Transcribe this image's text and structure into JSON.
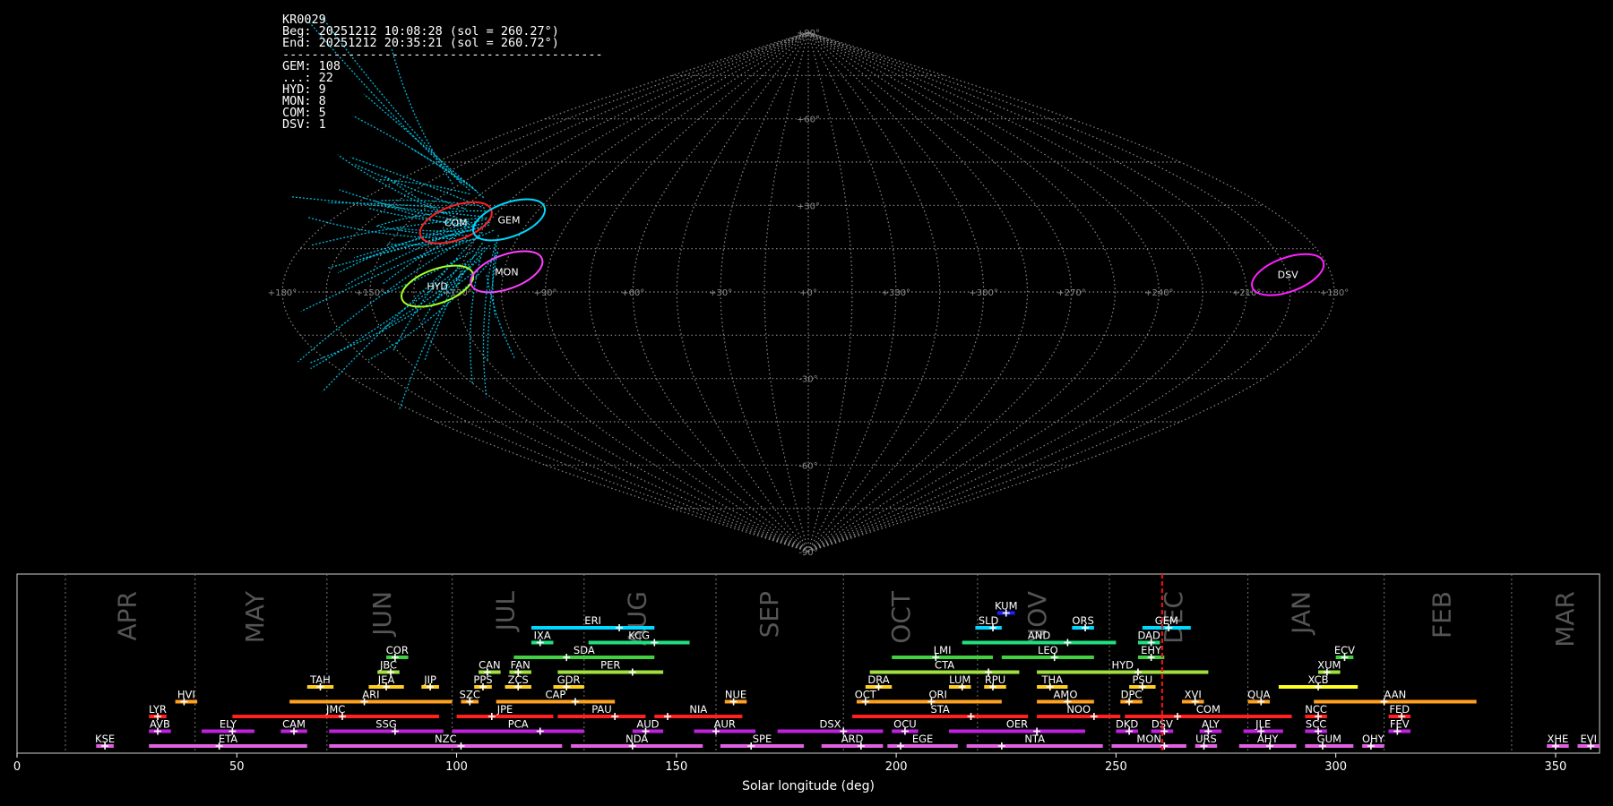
{
  "header": {
    "station": "KR0029",
    "beg": "Beg: 20251212 10:08:28 (sol = 260.27°)",
    "end": "End: 20251212 20:35:21 (sol = 260.72°)",
    "separator": "--------------------------------------------",
    "counts": [
      "GEM: 108",
      "...: 22",
      "HYD: 9",
      "MON: 8",
      "COM: 5",
      "DSV: 1"
    ]
  },
  "chart_data": [
    {
      "type": "scatter",
      "projection": "sinusoidal",
      "lon_labels": [
        {
          "lon": 180,
          "text": "+180°"
        },
        {
          "lon": 150,
          "text": "+150°"
        },
        {
          "lon": 120,
          "text": "+120°"
        },
        {
          "lon": 90,
          "text": "+90°"
        },
        {
          "lon": 60,
          "text": "+60°"
        },
        {
          "lon": 30,
          "text": "+30°"
        },
        {
          "lon": 0,
          "text": "+0°"
        },
        {
          "lon": -30,
          "text": "+330°"
        },
        {
          "lon": -60,
          "text": "+300°"
        },
        {
          "lon": -90,
          "text": "+270°"
        },
        {
          "lon": -120,
          "text": "+240°"
        },
        {
          "lon": -150,
          "text": "+210°"
        },
        {
          "lon": -180,
          "text": "+180°"
        }
      ],
      "lat_labels": [
        {
          "lat": 90,
          "text": "+90°"
        },
        {
          "lat": 60,
          "text": "+60°"
        },
        {
          "lat": 30,
          "text": "+30°"
        },
        {
          "lat": -30,
          "text": "-30°"
        },
        {
          "lat": -60,
          "text": "-60°"
        },
        {
          "lat": -90,
          "text": "-90°"
        }
      ],
      "radiants": [
        {
          "code": "COM",
          "lon": 132,
          "lat": 24,
          "color": "#ff2020"
        },
        {
          "code": "GEM",
          "lon": 113,
          "lat": 25,
          "color": "#00d8ff"
        },
        {
          "code": "HYD",
          "lon": 127,
          "lat": 2,
          "color": "#a8ff20"
        },
        {
          "code": "MON",
          "lon": 104,
          "lat": 7,
          "color": "#ff40ff"
        },
        {
          "code": "DSV",
          "lon": -165,
          "lat": 6,
          "color": "#ff20ff"
        }
      ],
      "trails_color": "#00d8ff"
    },
    {
      "type": "timeline",
      "xlabel": "Solar longitude (deg)",
      "xlim": [
        0,
        360
      ],
      "xticks": [
        0,
        50,
        100,
        150,
        200,
        250,
        300,
        350
      ],
      "current_sol": 260.5,
      "month_lines": [
        11,
        40.5,
        70.5,
        99,
        129,
        159,
        188,
        218.5,
        248.5,
        280,
        311,
        340
      ],
      "months": [
        {
          "text": "APR",
          "sol": 25
        },
        {
          "text": "MAY",
          "sol": 54
        },
        {
          "text": "JUN",
          "sol": 83
        },
        {
          "text": "JUL",
          "sol": 111
        },
        {
          "text": "AUG",
          "sol": 141
        },
        {
          "text": "SEP",
          "sol": 171
        },
        {
          "text": "OCT",
          "sol": 201
        },
        {
          "text": "NOV",
          "sol": 232
        },
        {
          "text": "DEC",
          "sol": 263
        },
        {
          "text": "JAN",
          "sol": 292
        },
        {
          "text": "FEB",
          "sol": 324
        },
        {
          "text": "MAR",
          "sol": 352
        }
      ],
      "showers": [
        {
          "code": "KUM",
          "row": 9,
          "start": 223,
          "end": 227,
          "peak": 225,
          "color": "#2020ff"
        },
        {
          "code": "ERI",
          "row": 8,
          "start": 117,
          "end": 145,
          "peak": 137,
          "color": "#00d8ff"
        },
        {
          "code": "SLD",
          "row": 8,
          "start": 218,
          "end": 224,
          "peak": 222,
          "color": "#00d8ff"
        },
        {
          "code": "ORS",
          "row": 8,
          "start": 240,
          "end": 245,
          "peak": 243,
          "color": "#00d8ff"
        },
        {
          "code": "GEM",
          "row": 8,
          "start": 256,
          "end": 267,
          "peak": 262,
          "color": "#00d8ff"
        },
        {
          "code": "IXA",
          "row": 7,
          "start": 117,
          "end": 122,
          "peak": 119,
          "color": "#20e080"
        },
        {
          "code": "KCG",
          "row": 7,
          "start": 130,
          "end": 153,
          "peak": 145,
          "color": "#20e080"
        },
        {
          "code": "AND",
          "row": 7,
          "start": 215,
          "end": 250,
          "peak": 239,
          "color": "#20e080"
        },
        {
          "code": "DAD",
          "row": 7,
          "start": 255,
          "end": 260,
          "peak": 258,
          "color": "#20e080"
        },
        {
          "code": "COR",
          "row": 6,
          "start": 84,
          "end": 89,
          "peak": 86,
          "color": "#40d040"
        },
        {
          "code": "SDA",
          "row": 6,
          "start": 113,
          "end": 145,
          "peak": 125,
          "color": "#40d040"
        },
        {
          "code": "LMI",
          "row": 6,
          "start": 199,
          "end": 222,
          "peak": 209,
          "color": "#40d040"
        },
        {
          "code": "LEO",
          "row": 6,
          "start": 224,
          "end": 245,
          "peak": 236,
          "color": "#40d040"
        },
        {
          "code": "EHY",
          "row": 6,
          "start": 255,
          "end": 261,
          "peak": 258,
          "color": "#40d040"
        },
        {
          "code": "ECV",
          "row": 6,
          "start": 300,
          "end": 304,
          "peak": 302,
          "color": "#40d040"
        },
        {
          "code": "JBC",
          "row": 5,
          "start": 82,
          "end": 87,
          "peak": 85,
          "color": "#a0e040"
        },
        {
          "code": "CAN",
          "row": 5,
          "start": 105,
          "end": 110,
          "peak": 107,
          "color": "#a0e040"
        },
        {
          "code": "FAN",
          "row": 5,
          "start": 112,
          "end": 117,
          "peak": 114,
          "color": "#a0e040"
        },
        {
          "code": "PER",
          "row": 5,
          "start": 123,
          "end": 147,
          "peak": 140,
          "color": "#a0e040"
        },
        {
          "code": "CTA",
          "row": 5,
          "start": 194,
          "end": 228,
          "peak": 221,
          "color": "#a0e040"
        },
        {
          "code": "HYD",
          "row": 5,
          "start": 232,
          "end": 271,
          "peak": 255,
          "color": "#a0e040"
        },
        {
          "code": "XUM",
          "row": 5,
          "start": 296,
          "end": 301,
          "peak": 298,
          "color": "#a0e040"
        },
        {
          "code": "TAH",
          "row": 4,
          "start": 66,
          "end": 72,
          "peak": 69,
          "color": "#ffd020"
        },
        {
          "code": "JEA",
          "row": 4,
          "start": 80,
          "end": 88,
          "peak": 84,
          "color": "#ffd020"
        },
        {
          "code": "JIP",
          "row": 4,
          "start": 92,
          "end": 96,
          "peak": 94,
          "color": "#ffd020"
        },
        {
          "code": "PPS",
          "row": 4,
          "start": 104,
          "end": 108,
          "peak": 106,
          "color": "#ffd020"
        },
        {
          "code": "ZCS",
          "row": 4,
          "start": 111,
          "end": 117,
          "peak": 114,
          "color": "#ffd020"
        },
        {
          "code": "GDR",
          "row": 4,
          "start": 122,
          "end": 129,
          "peak": 125,
          "color": "#ffd020"
        },
        {
          "code": "DRA",
          "row": 4,
          "start": 193,
          "end": 199,
          "peak": 196,
          "color": "#ffd020"
        },
        {
          "code": "LUM",
          "row": 4,
          "start": 212,
          "end": 217,
          "peak": 215,
          "color": "#ffd020"
        },
        {
          "code": "RPU",
          "row": 4,
          "start": 220,
          "end": 225,
          "peak": 222,
          "color": "#ffd020"
        },
        {
          "code": "THA",
          "row": 4,
          "start": 232,
          "end": 239,
          "peak": 235,
          "color": "#ffd020"
        },
        {
          "code": "PSU",
          "row": 4,
          "start": 253,
          "end": 259,
          "peak": 256,
          "color": "#ffd020"
        },
        {
          "code": "XCB",
          "row": 4,
          "start": 287,
          "end": 305,
          "peak": 296,
          "color": "#ffff20"
        },
        {
          "code": "HVI",
          "row": 3,
          "start": 36,
          "end": 41,
          "peak": 38,
          "color": "#ffa020"
        },
        {
          "code": "ARI",
          "row": 3,
          "start": 62,
          "end": 99,
          "peak": 79,
          "color": "#ffa020"
        },
        {
          "code": "SZC",
          "row": 3,
          "start": 101,
          "end": 105,
          "peak": 103,
          "color": "#ffa020"
        },
        {
          "code": "CAP",
          "row": 3,
          "start": 109,
          "end": 136,
          "peak": 127,
          "color": "#ffa020"
        },
        {
          "code": "NUE",
          "row": 3,
          "start": 161,
          "end": 166,
          "peak": 163,
          "color": "#ffa020"
        },
        {
          "code": "OCT",
          "row": 3,
          "start": 191,
          "end": 195,
          "peak": 193,
          "color": "#ffa020"
        },
        {
          "code": "ORI",
          "row": 3,
          "start": 195,
          "end": 224,
          "peak": 208,
          "color": "#ffa020"
        },
        {
          "code": "AMO",
          "row": 3,
          "start": 232,
          "end": 245,
          "peak": 239,
          "color": "#ffa020"
        },
        {
          "code": "DPC",
          "row": 3,
          "start": 251,
          "end": 256,
          "peak": 253,
          "color": "#ffa020"
        },
        {
          "code": "XVI",
          "row": 3,
          "start": 265,
          "end": 270,
          "peak": 268,
          "color": "#ffa020"
        },
        {
          "code": "QUA",
          "row": 3,
          "start": 280,
          "end": 285,
          "peak": 283,
          "color": "#ffa020"
        },
        {
          "code": "AAN",
          "row": 3,
          "start": 295,
          "end": 332,
          "peak": 311,
          "color": "#ffa020"
        },
        {
          "code": "LYR",
          "row": 2,
          "start": 30,
          "end": 34,
          "peak": 32,
          "color": "#ff2020"
        },
        {
          "code": "JMC",
          "row": 2,
          "start": 49,
          "end": 96,
          "peak": 74,
          "color": "#ff2020"
        },
        {
          "code": "JPE",
          "row": 2,
          "start": 100,
          "end": 122,
          "peak": 108,
          "color": "#ff2020"
        },
        {
          "code": "PAU",
          "row": 2,
          "start": 123,
          "end": 143,
          "peak": 136,
          "color": "#ff2020"
        },
        {
          "code": "NIA",
          "row": 2,
          "start": 145,
          "end": 165,
          "peak": 148,
          "color": "#ff2020"
        },
        {
          "code": "STA",
          "row": 2,
          "start": 190,
          "end": 230,
          "peak": 217,
          "color": "#ff2020"
        },
        {
          "code": "NOO",
          "row": 2,
          "start": 232,
          "end": 251,
          "peak": 245,
          "color": "#ff2020"
        },
        {
          "code": "COM",
          "row": 2,
          "start": 252,
          "end": 290,
          "peak": 264,
          "color": "#ff2020"
        },
        {
          "code": "NCC",
          "row": 2,
          "start": 293,
          "end": 298,
          "peak": 296,
          "color": "#ff2020"
        },
        {
          "code": "FED",
          "row": 2,
          "start": 312,
          "end": 317,
          "peak": 315,
          "color": "#ff2020"
        },
        {
          "code": "AVB",
          "row": 1,
          "start": 30,
          "end": 35,
          "peak": 32,
          "color": "#c020e0"
        },
        {
          "code": "ELY",
          "row": 1,
          "start": 42,
          "end": 54,
          "peak": 49,
          "color": "#c020e0"
        },
        {
          "code": "CAM",
          "row": 1,
          "start": 60,
          "end": 66,
          "peak": 63,
          "color": "#c020e0"
        },
        {
          "code": "SSG",
          "row": 1,
          "start": 71,
          "end": 97,
          "peak": 86,
          "color": "#c020e0"
        },
        {
          "code": "PCA",
          "row": 1,
          "start": 99,
          "end": 129,
          "peak": 119,
          "color": "#c020e0"
        },
        {
          "code": "AUD",
          "row": 1,
          "start": 140,
          "end": 147,
          "peak": 143,
          "color": "#c020e0"
        },
        {
          "code": "AUR",
          "row": 1,
          "start": 154,
          "end": 168,
          "peak": 159,
          "color": "#c020e0"
        },
        {
          "code": "DSX",
          "row": 1,
          "start": 173,
          "end": 197,
          "peak": 188,
          "color": "#c020e0"
        },
        {
          "code": "OCU",
          "row": 1,
          "start": 199,
          "end": 205,
          "peak": 202,
          "color": "#c020e0"
        },
        {
          "code": "OER",
          "row": 1,
          "start": 212,
          "end": 243,
          "peak": 232,
          "color": "#c020e0"
        },
        {
          "code": "DKD",
          "row": 1,
          "start": 250,
          "end": 255,
          "peak": 253,
          "color": "#c020e0"
        },
        {
          "code": "DSV",
          "row": 1,
          "start": 258,
          "end": 263,
          "peak": 261,
          "color": "#c020e0"
        },
        {
          "code": "ALY",
          "row": 1,
          "start": 269,
          "end": 274,
          "peak": 271,
          "color": "#c020e0"
        },
        {
          "code": "JLE",
          "row": 1,
          "start": 279,
          "end": 288,
          "peak": 283,
          "color": "#c020e0"
        },
        {
          "code": "SCC",
          "row": 1,
          "start": 293,
          "end": 298,
          "peak": 296,
          "color": "#c020e0"
        },
        {
          "code": "FEV",
          "row": 1,
          "start": 312,
          "end": 317,
          "peak": 314,
          "color": "#c020e0"
        },
        {
          "code": "KSE",
          "row": 0,
          "start": 18,
          "end": 22,
          "peak": 20,
          "color": "#e060e0"
        },
        {
          "code": "ETA",
          "row": 0,
          "start": 30,
          "end": 66,
          "peak": 46,
          "color": "#e060e0"
        },
        {
          "code": "NZC",
          "row": 0,
          "start": 71,
          "end": 124,
          "peak": 101,
          "color": "#e060e0"
        },
        {
          "code": "NDA",
          "row": 0,
          "start": 126,
          "end": 156,
          "peak": 140,
          "color": "#e060e0"
        },
        {
          "code": "SPE",
          "row": 0,
          "start": 160,
          "end": 179,
          "peak": 167,
          "color": "#e060e0"
        },
        {
          "code": "ARD",
          "row": 0,
          "start": 183,
          "end": 197,
          "peak": 192,
          "color": "#e060e0"
        },
        {
          "code": "EGE",
          "row": 0,
          "start": 198,
          "end": 214,
          "peak": 201,
          "color": "#e060e0"
        },
        {
          "code": "NTA",
          "row": 0,
          "start": 216,
          "end": 247,
          "peak": 224,
          "color": "#e060e0"
        },
        {
          "code": "MON",
          "row": 0,
          "start": 249,
          "end": 266,
          "peak": 261,
          "color": "#e060e0"
        },
        {
          "code": "URS",
          "row": 0,
          "start": 268,
          "end": 273,
          "peak": 270,
          "color": "#e060e0"
        },
        {
          "code": "AHY",
          "row": 0,
          "start": 278,
          "end": 291,
          "peak": 285,
          "color": "#e060e0"
        },
        {
          "code": "GUM",
          "row": 0,
          "start": 293,
          "end": 304,
          "peak": 297,
          "color": "#e060e0"
        },
        {
          "code": "OHY",
          "row": 0,
          "start": 306,
          "end": 311,
          "peak": 308,
          "color": "#e060e0"
        },
        {
          "code": "XHE",
          "row": 0,
          "start": 348,
          "end": 353,
          "peak": 350,
          "color": "#e060e0"
        },
        {
          "code": "EVI",
          "row": 0,
          "start": 355,
          "end": 360,
          "peak": 358,
          "color": "#e060e0"
        }
      ]
    }
  ]
}
